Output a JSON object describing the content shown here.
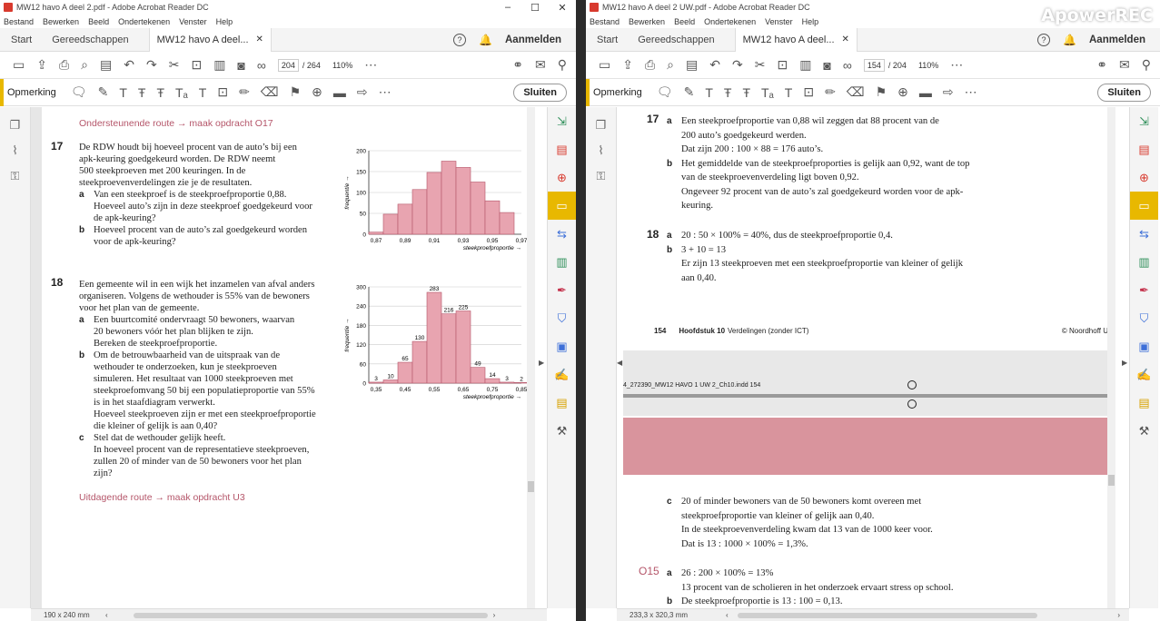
{
  "left": {
    "title": "MW12 havo A deel 2.pdf - Adobe Acrobat Reader DC",
    "menu": [
      "Bestand",
      "Bewerken",
      "Beeld",
      "Ondertekenen",
      "Venster",
      "Help"
    ],
    "tabs": {
      "start": "Start",
      "tools": "Gereedschappen",
      "doc": "MW12 havo A deel...",
      "login": "Aanmelden"
    },
    "page_current": "204",
    "page_total": "/ 264",
    "zoom": "110%",
    "comment_label": "Opmerking",
    "close_label": "Sluiten",
    "page_size": "190 x 240 mm",
    "route_top": "Ondersteunende route → maak opdracht O17",
    "q17": {
      "num": "17",
      "intro": [
        "De RDW houdt bij hoeveel procent van de auto’s bij een",
        "apk-keuring goedgekeurd worden. De RDW neemt",
        "500 steekproeven met 200 keuringen. In de",
        "steekproevenverdelingen zie je de resultaten."
      ],
      "a": [
        "Van een steekproef is de steekproefproportie 0,88.",
        "Hoeveel auto’s zijn in deze steekproef goedgekeurd voor",
        "de apk-keuring?"
      ],
      "b": [
        "Hoeveel procent van de auto’s zal goedgekeurd worden",
        "voor de apk-keuring?"
      ]
    },
    "q18": {
      "num": "18",
      "intro": [
        "Een gemeente wil in een wijk het inzamelen van afval anders",
        "organiseren. Volgens de wethouder is 55% van de bewoners",
        "voor het plan van de gemeente."
      ],
      "a": [
        "Een buurtcomité ondervraagt 50 bewoners, waarvan",
        "20 bewoners vóór het plan blijken te zijn.",
        "Bereken de steekproefproportie."
      ],
      "b": [
        "Om de betrouwbaarheid van de uitspraak van de",
        "wethouder te onderzoeken, kun je steekproeven",
        "simuleren. Het resultaat van 1000 steekproeven met",
        "steekproefomvang 50 bij een populatieproportie van 55%",
        "is in het staafdiagram verwerkt.",
        "Hoeveel steekproeven zijn er met een steekproefproportie",
        "die kleiner of gelijk is aan 0,40?"
      ],
      "c": [
        "Stel dat de wethouder gelijk heeft.",
        "In hoeveel procent van de representatieve steekproeven,",
        "zullen 20 of minder van de 50 bewoners voor het plan",
        "zijn?"
      ]
    },
    "route_bottom": "Uitdagende route → maak opdracht U3",
    "labels": {
      "a": "a",
      "b": "b",
      "c": "c"
    }
  },
  "right": {
    "title": "MW12 havo A deel 2 UW.pdf - Adobe Acrobat Reader DC",
    "menu": [
      "Bestand",
      "Bewerken",
      "Beeld",
      "Ondertekenen",
      "Venster",
      "Help"
    ],
    "tabs": {
      "start": "Start",
      "tools": "Gereedschappen",
      "doc": "MW12 havo A deel...",
      "login": "Aanmelden"
    },
    "page_current": "154",
    "page_total": "/ 204",
    "zoom": "110%",
    "comment_label": "Opmerking",
    "close_label": "Sluiten",
    "page_size": "233,3 x 320,3 mm",
    "watermark": "ApowerREC",
    "a17": {
      "num": "17",
      "a": [
        "Een steekproefproportie van 0,88 wil zeggen dat 88 procent van de",
        "200 auto’s goedgekeurd werden.",
        "Dat zijn 200 : 100 × 88 = 176 auto’s."
      ],
      "b": [
        "Het gemiddelde van de steekproefproporties is gelijk aan 0,92, want de top",
        "van de steekproevenverdeling ligt boven 0,92.",
        "Ongeveer 92 procent van de auto’s zal goedgekeurd worden voor de apk-",
        "keuring."
      ]
    },
    "a18": {
      "num": "18",
      "a": [
        "20 : 50 × 100% = 40%, dus de steekproefproportie 0,4."
      ],
      "b": [
        "3 + 10 = 13",
        "Er zijn 13 steekproeven met een steekproefproportie van kleiner of gelijk",
        "aan 0,40."
      ]
    },
    "footer": {
      "page": "154",
      "chapter": "Hoofdstuk 10",
      "chapter_rest": "Verdelingen (zonder ICT)",
      "copyright": "© Noordhoff U"
    },
    "indd": "4_272390_MW12 HAVO 1 UW 2_Ch10.indd   154",
    "a18c": [
      "20 of minder bewoners van de 50 bewoners komt overeen met",
      "steekproefproportie van kleiner of gelijk aan 0,40.",
      "In de steekproevenverdeling kwam dat 13 van de 1000 keer voor.",
      "Dat is 13 : 1000 × 100% = 1,3%."
    ],
    "o15": {
      "num": "O15",
      "a": [
        "26 : 200 × 100% = 13%",
        "13 procent van de scholieren in het onderzoek ervaart stress op school."
      ],
      "b": [
        "De steekproefproportie is 13 : 100 = 0,13."
      ]
    },
    "labels": {
      "a": "a",
      "b": "b",
      "c": "c"
    }
  },
  "chart_data": [
    {
      "type": "bar",
      "ylabel": "frequentie",
      "xlabel": "steekproefproportie",
      "x_ticks": [
        "0,87",
        "0,89",
        "0,91",
        "0,93",
        "0,95",
        "0,97"
      ],
      "x": [
        0.87,
        0.88,
        0.89,
        0.9,
        0.91,
        0.92,
        0.93,
        0.94,
        0.95,
        0.96
      ],
      "values": [
        5,
        48,
        72,
        107,
        148,
        175,
        160,
        125,
        80,
        52
      ],
      "y_ticks": [
        0,
        50,
        100,
        150,
        200
      ],
      "ylim": [
        0,
        200
      ]
    },
    {
      "type": "bar",
      "ylabel": "frequentie",
      "xlabel": "steekproefproportie",
      "x_ticks": [
        "0,35",
        "0,45",
        "0,55",
        "0,65",
        "0,75",
        "0,85"
      ],
      "x": [
        0.35,
        0.4,
        0.45,
        0.5,
        0.55,
        0.6,
        0.65,
        0.7,
        0.75,
        0.8
      ],
      "values": [
        3,
        10,
        65,
        130,
        283,
        216,
        225,
        49,
        14,
        3
      ],
      "bar_labels": [
        "3",
        "10",
        "65",
        "130",
        "283",
        "216",
        "225",
        "49",
        "14",
        "3",
        "2"
      ],
      "y_ticks": [
        0,
        60,
        120,
        180,
        240,
        300
      ],
      "ylim": [
        0,
        300
      ]
    }
  ],
  "colors": {
    "accent": "#e8b800",
    "route": "#b5566a",
    "bar": "#e8a4b0",
    "pink_band": "#d9949d"
  }
}
